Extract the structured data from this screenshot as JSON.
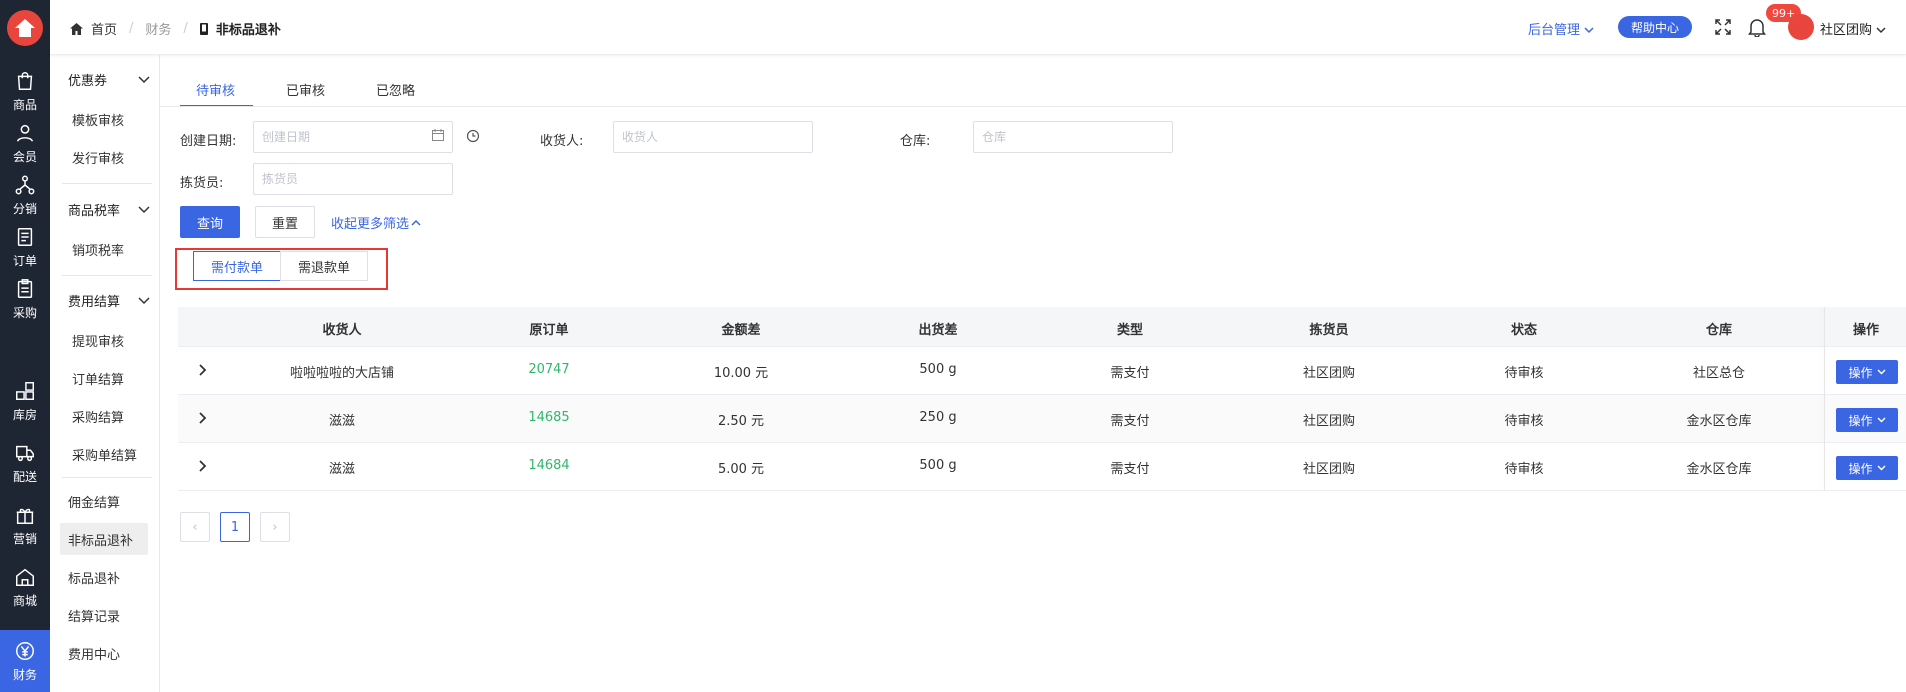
{
  "header": {
    "breadcrumb": [
      "首页",
      "财务",
      "非标品退补"
    ],
    "admin_menu": "后台管理",
    "help_button": "帮助中心",
    "notification_badge": "99+",
    "user_name": "社区团购"
  },
  "rail": {
    "items": [
      {
        "label": "商品",
        "icon": "bag-icon"
      },
      {
        "label": "会员",
        "icon": "user-icon"
      },
      {
        "label": "分销",
        "icon": "network-icon"
      },
      {
        "label": "订单",
        "icon": "document-icon"
      },
      {
        "label": "采购",
        "icon": "clipboard-icon"
      },
      {
        "label": "库房",
        "icon": "grid-icon"
      },
      {
        "label": "配送",
        "icon": "truck-icon"
      },
      {
        "label": "营销",
        "icon": "gift-icon"
      },
      {
        "label": "商城",
        "icon": "home-icon"
      },
      {
        "label": "财务",
        "icon": "yen-icon",
        "active": true
      }
    ]
  },
  "submenu": {
    "coupons": "优惠券",
    "template_review": "模板审核",
    "issue_review": "发行审核",
    "tax_rate": "商品税率",
    "sales_tax": "销项税率",
    "fee_settlement": "费用结算",
    "withdraw_review": "提现审核",
    "order_settlement": "订单结算",
    "purchase_settlement": "采购结算",
    "purchase_order_settlement": "采购单结算",
    "commission_settlement": "佣金结算",
    "nonstandard_refund": "非标品退补",
    "standard_refund": "标品退补",
    "settlement_records": "结算记录",
    "fee_center": "费用中心"
  },
  "tabs": [
    "待审核",
    "已审核",
    "已忽略"
  ],
  "filters": {
    "create_date_label": "创建日期:",
    "create_date_placeholder": "创建日期",
    "receiver_label": "收货人:",
    "receiver_placeholder": "收货人",
    "warehouse_label": "仓库:",
    "warehouse_placeholder": "仓库",
    "picker_label": "拣货员:",
    "picker_placeholder": "拣货员",
    "query_button": "查询",
    "reset_button": "重置",
    "collapse_link": "收起更多筛选"
  },
  "segments": [
    "需付款单",
    "需退款单"
  ],
  "table": {
    "headers": [
      "收货人",
      "原订单",
      "金额差",
      "出货差",
      "类型",
      "拣货员",
      "状态",
      "仓库",
      "操作"
    ],
    "rows": [
      {
        "receiver": "啦啦啦啦的大店铺",
        "order": "20747",
        "amount": "10.00 元",
        "weight": "500 g",
        "type": "需支付",
        "picker": "社区团购",
        "status": "待审核",
        "warehouse": "社区总仓",
        "action": "操作"
      },
      {
        "receiver": "滋滋",
        "order": "14685",
        "amount": "2.50 元",
        "weight": "250 g",
        "type": "需支付",
        "picker": "社区团购",
        "status": "待审核",
        "warehouse": "金水区仓库",
        "action": "操作"
      },
      {
        "receiver": "滋滋",
        "order": "14684",
        "amount": "5.00 元",
        "weight": "500 g",
        "type": "需支付",
        "picker": "社区团购",
        "status": "待审核",
        "warehouse": "金水区仓库",
        "action": "操作"
      }
    ]
  },
  "pagination": {
    "current": "1",
    "prev": "‹",
    "next": "›"
  }
}
